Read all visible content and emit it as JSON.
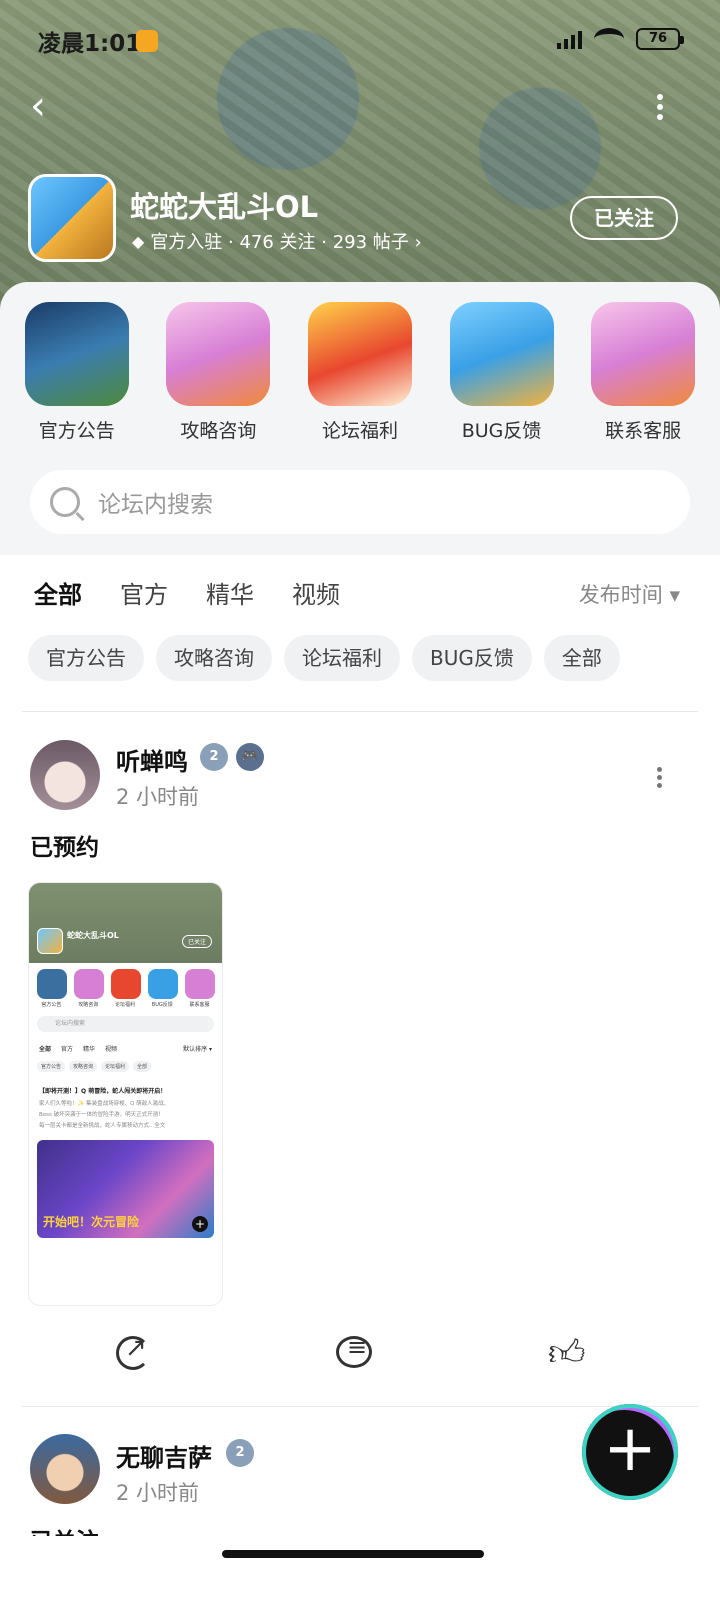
{
  "status_bar": {
    "time": "凌晨1:01",
    "battery": "76"
  },
  "header": {
    "game_title": "蛇蛇大乱斗OL",
    "meta": "官方入驻 · 476 关注 · 293 帖子 ›",
    "follow_label": "已关注"
  },
  "shortcuts": [
    {
      "label": "官方公告"
    },
    {
      "label": "攻略咨询"
    },
    {
      "label": "论坛福利"
    },
    {
      "label": "BUG反馈"
    },
    {
      "label": "联系客服"
    }
  ],
  "search": {
    "placeholder": "论坛内搜索"
  },
  "tabs": [
    {
      "label": "全部"
    },
    {
      "label": "官方"
    },
    {
      "label": "精华"
    },
    {
      "label": "视频"
    }
  ],
  "sort_label": "发布时间 ▾",
  "chips": [
    {
      "label": "官方公告"
    },
    {
      "label": "攻略咨询"
    },
    {
      "label": "论坛福利"
    },
    {
      "label": "BUG反馈"
    },
    {
      "label": "全部"
    }
  ],
  "posts": [
    {
      "username": "听蝉鸣",
      "time": "2 小时前",
      "text": "已预约"
    },
    {
      "username": "无聊吉萨",
      "time": "2 小时前",
      "text": "已关注"
    }
  ],
  "screenshot_thumb": {
    "title": "蛇蛇大乱斗OL",
    "follow": "已关注",
    "labels": [
      "官方公告",
      "攻略咨询",
      "论坛福利",
      "BUG反馈",
      "联系客服"
    ],
    "search": "论坛内搜索",
    "tabs": [
      "全部",
      "官方",
      "精华",
      "视频",
      "默认排序 ▾"
    ],
    "chips": [
      "官方公告",
      "攻略咨询",
      "论坛福利",
      "全部"
    ],
    "post_title": "【即将开测！】Q 萌冒险，蛇人闯关即将开启！",
    "post_body_1": "家人们久等啦！✨ 集装盘战场穿梭、Q 萌敌人激战、",
    "post_body_2": "Boss 破坏突袭于一体的冒险手游，明天正式开测！",
    "post_body_3": "每一层关卡都是全新挑战，蛇人专属移动方式...全文",
    "art_text": "开始吧！次元冒险"
  },
  "badges": {
    "level": "2"
  }
}
